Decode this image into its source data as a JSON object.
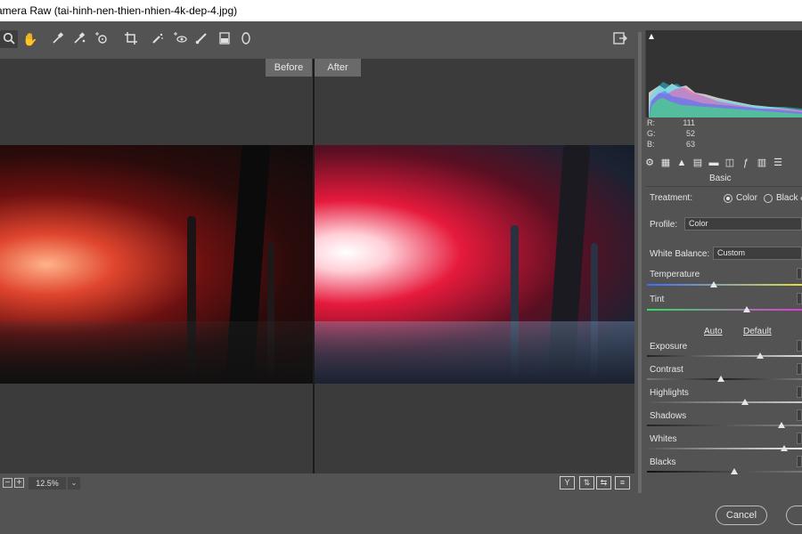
{
  "window": {
    "title": "amera Raw (tai-hinh-nen-thien-nhien-4k-dep-4.jpg)"
  },
  "toolbar": {
    "tools": [
      "zoom-icon",
      "hand-icon",
      "white-balance-icon",
      "color-sampler-icon",
      "targeted-adjust-icon",
      "crop-icon",
      "spot-removal-icon",
      "red-eye-icon",
      "brush-icon",
      "graduated-filter-icon",
      "radial-filter-icon"
    ],
    "export_icon": "export-icon"
  },
  "preview": {
    "before_label": "Before",
    "after_label": "After"
  },
  "status": {
    "zoom_value": "12.5%",
    "zoom_minus": "−",
    "zoom_plus": "+",
    "dropdown": "⌄",
    "view_buttons": [
      "Y",
      "⇅",
      "⇆",
      "≡"
    ]
  },
  "histogram": {
    "r_label": "R:",
    "r_value": "111",
    "g_label": "G:",
    "g_value": "52",
    "b_label": "B:",
    "b_value": "63"
  },
  "panel": {
    "title": "Basic",
    "treatment_label": "Treatment:",
    "treatment_color": "Color",
    "treatment_bw": "Black &",
    "profile_label": "Profile:",
    "profile_value": "Color",
    "wb_label": "White Balance:",
    "wb_value": "Custom",
    "temperature_label": "Temperature",
    "tint_label": "Tint",
    "auto_label": "Auto",
    "default_label": "Default",
    "exposure_label": "Exposure",
    "contrast_label": "Contrast",
    "highlights_label": "Highlights",
    "shadows_label": "Shadows",
    "whites_label": "Whites",
    "blacks_label": "Blacks"
  },
  "footer": {
    "cancel_label": "Cancel"
  },
  "colors": {
    "accent": "#535353",
    "preview_bg": "#3b3b3b"
  }
}
